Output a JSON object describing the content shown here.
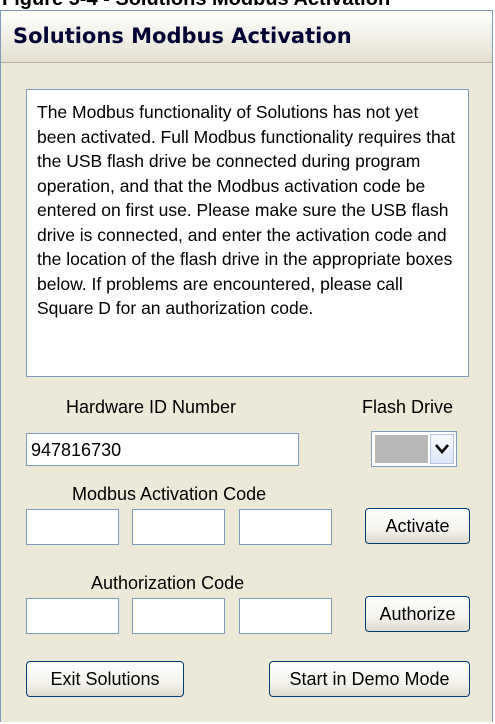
{
  "window": {
    "top_cut_text": "Figure 5-4 - Solutions Modbus Activation",
    "title": "Solutions Modbus Activation"
  },
  "info": {
    "text": "The Modbus functionality of Solutions has not yet been activated.  Full Modbus functionality requires that the USB flash drive be connected during program operation, and that the Modbus activation code be entered on first use.  Please make sure the USB flash drive is connected, and enter the activation code and the location of the flash drive in the appropriate boxes below.  If problems are encountered, please call Square D for an authorization code."
  },
  "hardware": {
    "label": "Hardware ID Number",
    "value": "947816730"
  },
  "flash_drive": {
    "label": "Flash Drive",
    "selected": ""
  },
  "activation": {
    "label": "Modbus Activation Code",
    "fields": [
      "",
      "",
      ""
    ],
    "button": "Activate"
  },
  "authorization": {
    "label": "Authorization Code",
    "fields": [
      "",
      "",
      ""
    ],
    "button": "Authorize"
  },
  "footer": {
    "exit_button": "Exit Solutions",
    "demo_button": "Start in Demo Mode"
  }
}
